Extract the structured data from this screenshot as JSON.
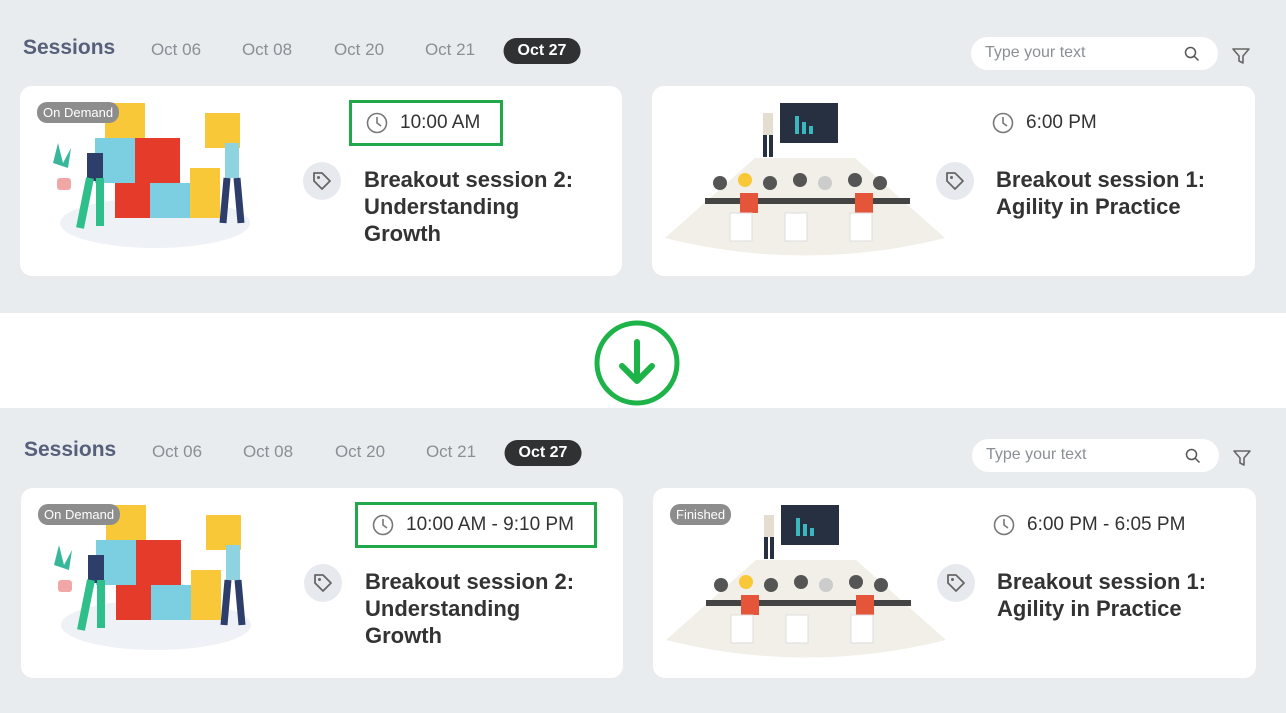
{
  "panels": [
    {
      "title": "Sessions",
      "tabs": [
        "Oct 06",
        "Oct 08",
        "Oct 20",
        "Oct 21",
        "Oct 27"
      ],
      "active_tab": "Oct 27",
      "search_placeholder": "Type your text",
      "cards": [
        {
          "badge": "On Demand",
          "time": "10:00 AM",
          "title": "Breakout session 2: Understanding Growth"
        },
        {
          "badge": "",
          "time": "6:00 PM",
          "title": "Breakout session 1: Agility in Practice"
        }
      ]
    },
    {
      "title": "Sessions",
      "tabs": [
        "Oct 06",
        "Oct 08",
        "Oct 20",
        "Oct 21",
        "Oct 27"
      ],
      "active_tab": "Oct 27",
      "search_placeholder": "Type your text",
      "cards": [
        {
          "badge": "On Demand",
          "time": "10:00 AM - 9:10 PM",
          "title": "Breakout session 2: Understanding Growth"
        },
        {
          "badge": "Finished",
          "time": "6:00 PM - 6:05 PM",
          "title": "Breakout session 1: Agility in Practice"
        }
      ]
    }
  ],
  "colors": {
    "highlight": "#22a84a",
    "arrow": "#1db348",
    "active_tab": "#2f3133"
  },
  "icons": {
    "arrow": "arrow-down-circle-icon",
    "clock": "clock-icon",
    "tag": "tag-icon",
    "search": "search-icon",
    "filter": "filter-icon"
  }
}
